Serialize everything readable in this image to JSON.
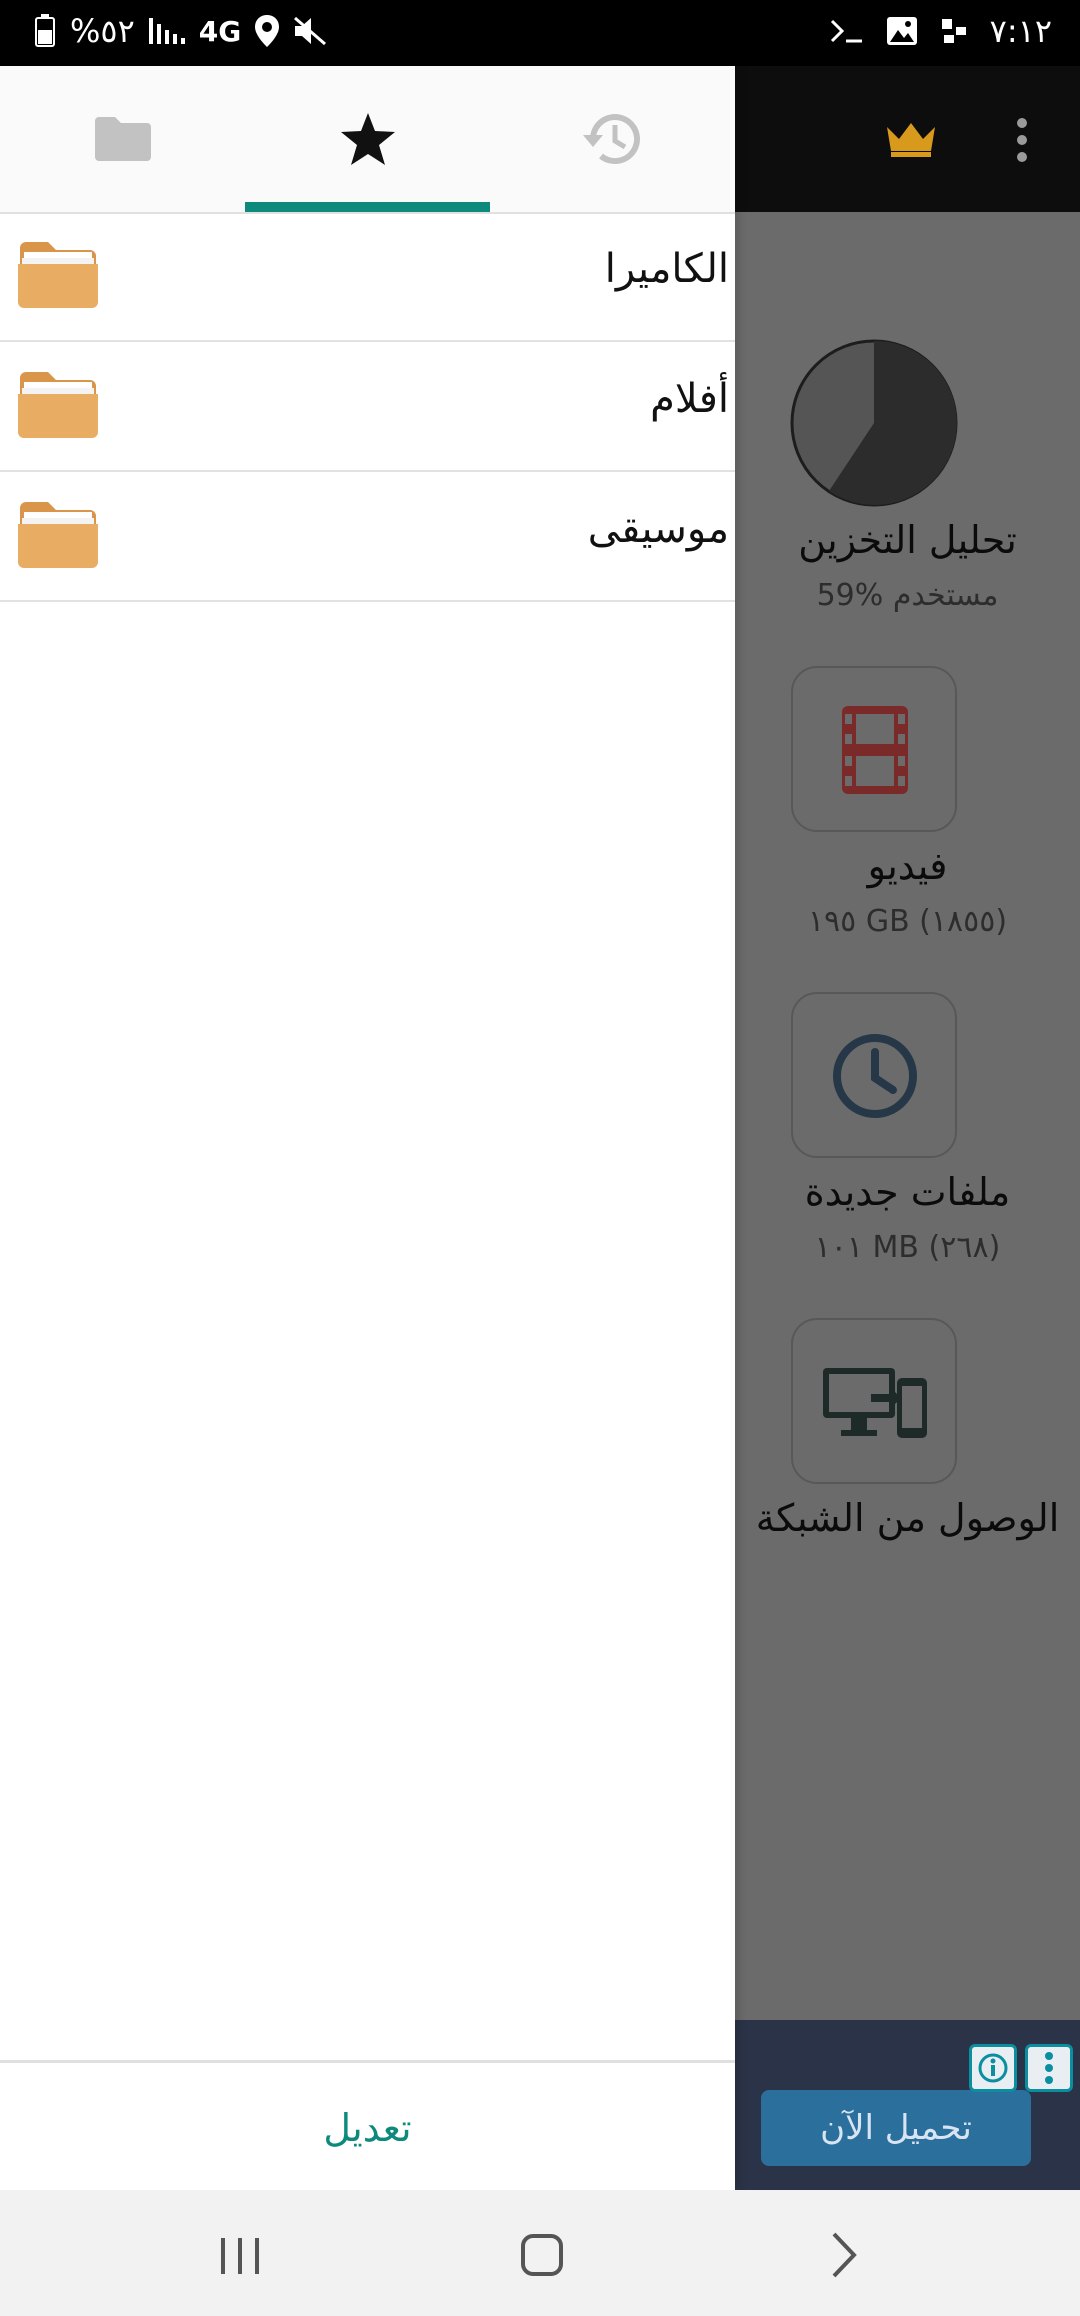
{
  "status_bar": {
    "battery": "%٥٢",
    "network": "4G",
    "time": "٧:١٢"
  },
  "drawer": {
    "tabs": [
      {
        "name": "folder-tab",
        "icon": "folder-icon",
        "selected": false
      },
      {
        "name": "favorites-tab",
        "icon": "star-icon",
        "selected": true
      },
      {
        "name": "recent-tab",
        "icon": "history-icon",
        "selected": false
      }
    ],
    "items": [
      {
        "label": "الكاميرا",
        "icon": "folder-icon"
      },
      {
        "label": "أفلام",
        "icon": "folder-icon"
      },
      {
        "label": "موسيقى",
        "icon": "folder-icon"
      }
    ],
    "edit_label": "تعديل",
    "accent": "#0d8a7c",
    "folder_color": "#e8ad62"
  },
  "background": {
    "storage": {
      "title": "تحليل التخزين",
      "subtitle": "59% مستخدم",
      "used_percent": 59
    },
    "video": {
      "title": "فيديو",
      "subtitle": "١٩٥ GB (١٨٥٥)"
    },
    "recent": {
      "title": "ملفات جديدة",
      "subtitle": "١٠١ MB (٢٦٨)"
    },
    "network": {
      "title": "الوصول من الشبكة"
    },
    "ad": {
      "button": "تحميل الآن"
    }
  }
}
